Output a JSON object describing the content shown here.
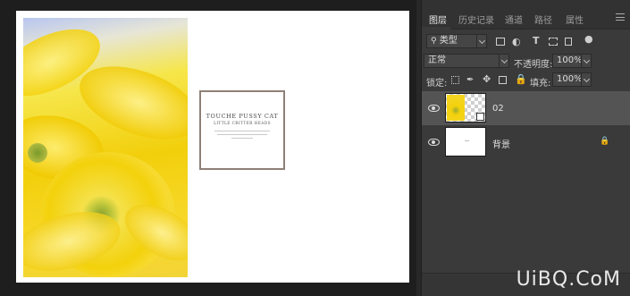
{
  "canvas": {
    "card": {
      "title": "TOUCHE PUSSY CAT",
      "subtitle": "LITTLE CRITTER HEADS"
    }
  },
  "panel": {
    "tabs": [
      {
        "label": "图层"
      },
      {
        "label": "历史记录"
      },
      {
        "label": "通道"
      },
      {
        "label": "路径"
      },
      {
        "label": "属性"
      }
    ],
    "filter": {
      "search_icon": "search-icon",
      "value": "类型"
    },
    "blend_mode": "正常",
    "opacity_label": "不透明度:",
    "opacity_value": "100%",
    "lock_label": "锁定:",
    "fill_label": "填充:",
    "fill_value": "100%",
    "layers": [
      {
        "name": "02",
        "selected": true,
        "visible": true
      },
      {
        "name": "背景",
        "selected": false,
        "visible": true,
        "locked": true
      }
    ]
  },
  "watermark": "UiBQ.CoM",
  "colors": {
    "panel_bg": "#3a3a3a",
    "selected_layer": "#545454",
    "workspace_bg": "#1e1e1e",
    "card_border": "#8f8078"
  }
}
